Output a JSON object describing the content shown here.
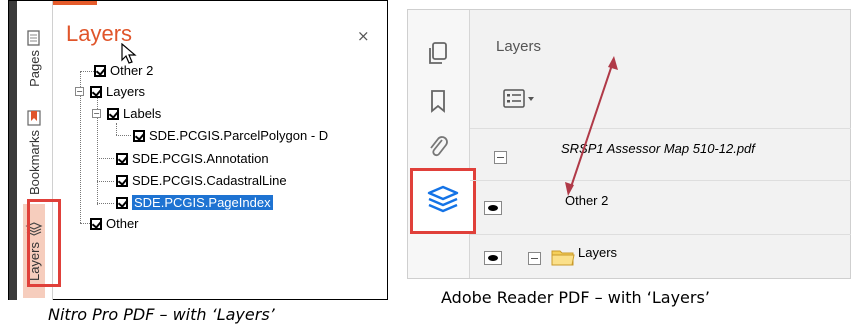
{
  "nitro": {
    "title": "Layers",
    "close": "×",
    "tabs": [
      "Pages",
      "Bookmarks",
      "Layers"
    ],
    "tree": {
      "other2": "Other 2",
      "layers": "Layers",
      "labels": "Labels",
      "parcel": "SDE.PCGIS.ParcelPolygon - D",
      "annotation": "SDE.PCGIS.Annotation",
      "cadastral": "SDE.PCGIS.CadastralLine",
      "pageindex": "SDE.PCGIS.PageIndex",
      "other": "Other"
    },
    "accent": "#e0552a",
    "selection": "#1e73d2"
  },
  "adobe": {
    "title": "Layers",
    "file": "SRSP1 Assessor Map 510-12.pdf",
    "other2": "Other 2",
    "layers": "Layers",
    "highlight": "#e0403a",
    "layers_icon_color": "#1473e6",
    "arrow_color": "#b03a48"
  },
  "captions": {
    "left": "Nitro Pro PDF – with ‘Layers’",
    "right": "Adobe Reader PDF – with ‘Layers’"
  }
}
